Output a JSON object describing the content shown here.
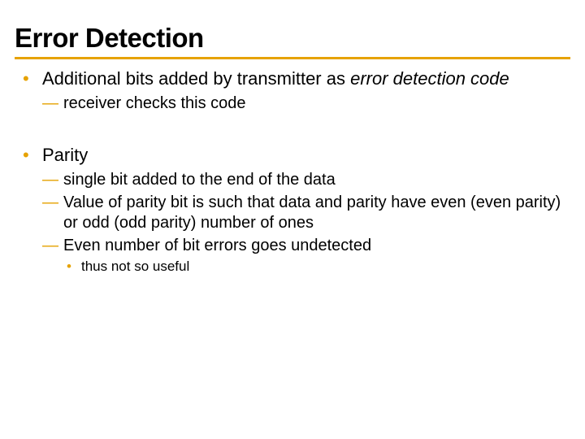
{
  "title": "Error Detection",
  "bullets": [
    {
      "text_pre": "Additional bits added by transmitter as ",
      "text_em": "error detection code",
      "sub": [
        {
          "text": "receiver checks this code"
        }
      ]
    },
    {
      "text": "Parity",
      "sub": [
        {
          "text": "single bit added to the end of the data"
        },
        {
          "text": "Value of parity bit is such that data and parity have even (even parity) or odd (odd parity) number of ones"
        },
        {
          "text": "Even number of bit errors goes undetected",
          "sub": [
            {
              "text": "thus not so useful"
            }
          ]
        }
      ]
    }
  ]
}
